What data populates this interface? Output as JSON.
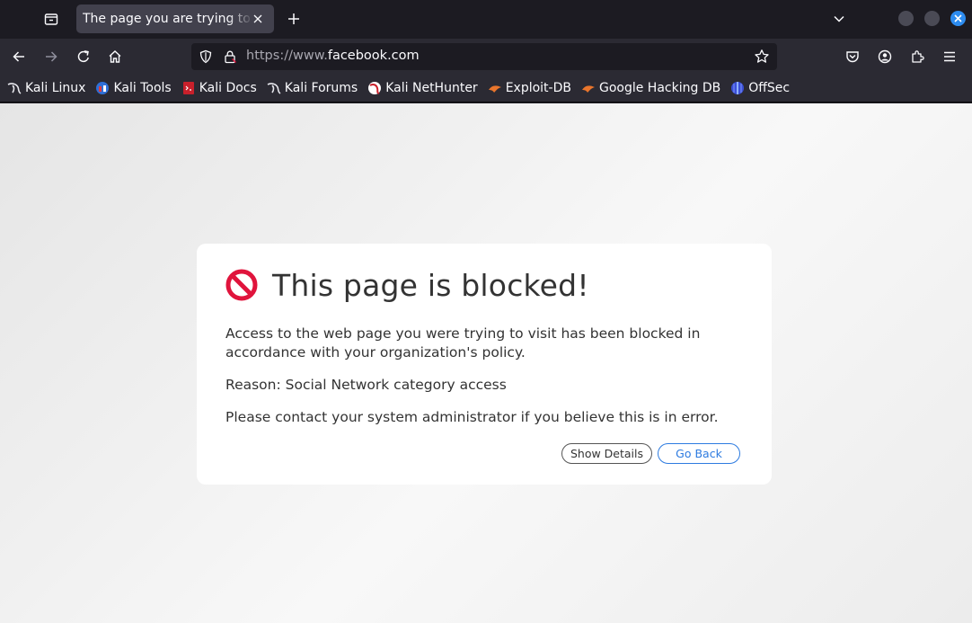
{
  "tab": {
    "title": "The page you are trying to access is blocked"
  },
  "url": {
    "prefix": "https://www.",
    "domain": "facebook.com"
  },
  "bookmarks": [
    {
      "label": "Kali Linux",
      "icon": "kali-dragon-icon"
    },
    {
      "label": "Kali Tools",
      "icon": "kali-tools-icon"
    },
    {
      "label": "Kali Docs",
      "icon": "kali-docs-icon"
    },
    {
      "label": "Kali Forums",
      "icon": "kali-dragon-icon"
    },
    {
      "label": "Kali NetHunter",
      "icon": "nethunter-icon"
    },
    {
      "label": "Exploit-DB",
      "icon": "exploit-db-icon"
    },
    {
      "label": "Google Hacking DB",
      "icon": "exploit-db-icon"
    },
    {
      "label": "OffSec",
      "icon": "offsec-icon"
    }
  ],
  "block_page": {
    "title": "This page is blocked!",
    "message": "Access to the web page you were trying to visit has been blocked in accordance with your organization's policy.",
    "reason": "Reason: Social Network category access",
    "contact": "Please contact your system administrator if you believe this is in error.",
    "show_details_label": "Show Details",
    "go_back_label": "Go Back"
  },
  "colors": {
    "block_icon": "#e0143c",
    "go_back": "#2d7be0",
    "window_close": "#2d8cf0"
  }
}
